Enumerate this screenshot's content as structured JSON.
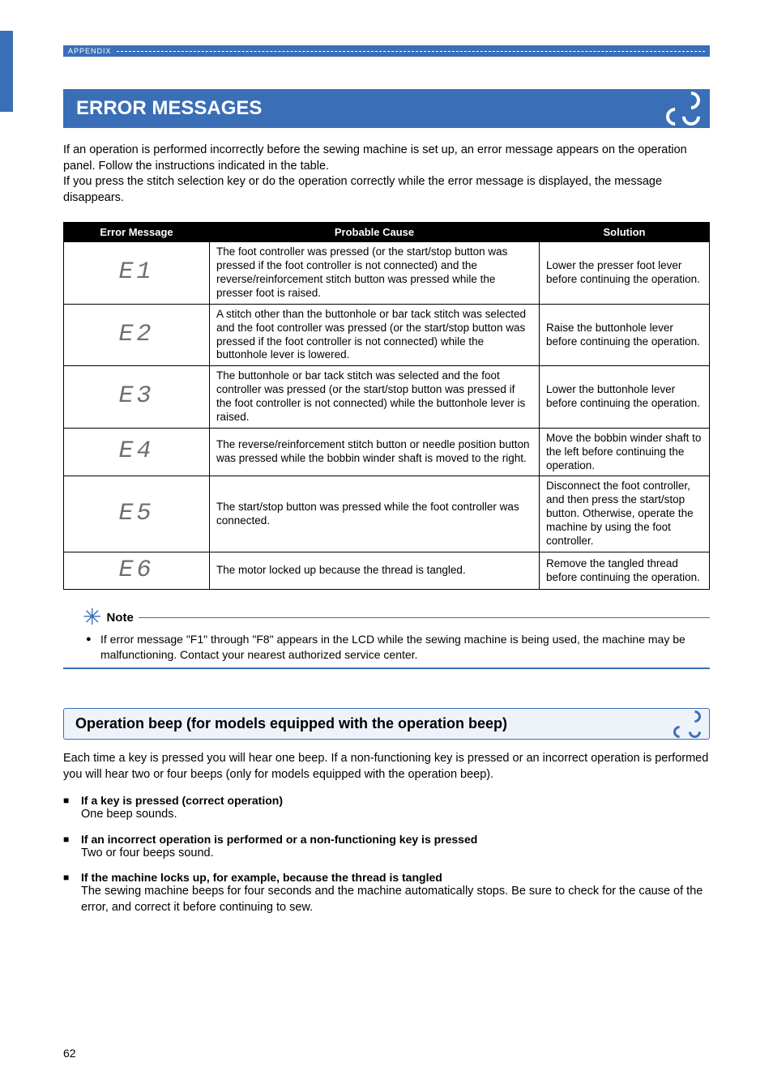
{
  "header": {
    "section": "APPENDIX"
  },
  "section_title": "ERROR MESSAGES",
  "intro_lines": [
    "If an operation is performed incorrectly before the sewing machine is set up, an error message appears on the operation panel. Follow the instructions indicated in the table.",
    "If you press the stitch selection key or do the operation correctly while the error message is displayed, the message disappears."
  ],
  "table": {
    "headers": [
      "Error Message",
      "Probable Cause",
      "Solution"
    ],
    "rows": [
      {
        "code": "E1",
        "cause": "The foot controller was pressed (or the start/stop button was pressed if the foot controller is not connected) and the reverse/reinforcement stitch button was pressed while the presser foot is raised.",
        "solution": "Lower the presser foot lever before continuing the operation."
      },
      {
        "code": "E2",
        "cause": "A stitch other than the buttonhole or bar tack stitch was selected and the foot controller was pressed (or the start/stop button was pressed if the foot controller is not connected) while the buttonhole lever is lowered.",
        "solution": "Raise the buttonhole lever before continuing the operation."
      },
      {
        "code": "E3",
        "cause": "The buttonhole or bar tack stitch was selected and the foot controller was pressed (or the start/stop button was pressed if the foot controller is not connected) while the buttonhole lever is raised.",
        "solution": "Lower the buttonhole lever before continuing the operation."
      },
      {
        "code": "E4",
        "cause": "The reverse/reinforcement stitch button or needle position button was pressed while the bobbin winder shaft is moved to the right.",
        "solution": "Move the bobbin winder shaft to the left before continuing the operation."
      },
      {
        "code": "E5",
        "cause": "The start/stop button was pressed while the foot controller was connected.",
        "solution": "Disconnect the foot controller, and then press the start/stop button. Otherwise, operate the machine by using the foot controller."
      },
      {
        "code": "E6",
        "cause": "The motor locked up because the thread is tangled.",
        "solution": "Remove the tangled thread before continuing the operation."
      }
    ]
  },
  "note": {
    "label": "Note",
    "text": "If error message \"F1\" through \"F8\" appears in the LCD while the sewing machine is being used, the machine may be malfunctioning. Contact your nearest authorized service center."
  },
  "subsection": {
    "title": "Operation beep (for models equipped with the operation beep)",
    "intro": "Each time a key is pressed you will hear one beep. If a non-functioning key is pressed or an incorrect operation is performed you will hear two or four beeps (only for models equipped with the operation beep).",
    "items": [
      {
        "title": "If a key is pressed (correct operation)",
        "body": "One beep sounds."
      },
      {
        "title": "If an incorrect operation is performed or a non-functioning key is pressed",
        "body": "Two or four beeps sound."
      },
      {
        "title": "If the machine locks up, for example, because the thread is tangled",
        "body": "The sewing machine beeps for four seconds and the machine automatically stops. Be sure to check for the cause of the error, and correct it before continuing to sew."
      }
    ]
  },
  "page_number": "62"
}
